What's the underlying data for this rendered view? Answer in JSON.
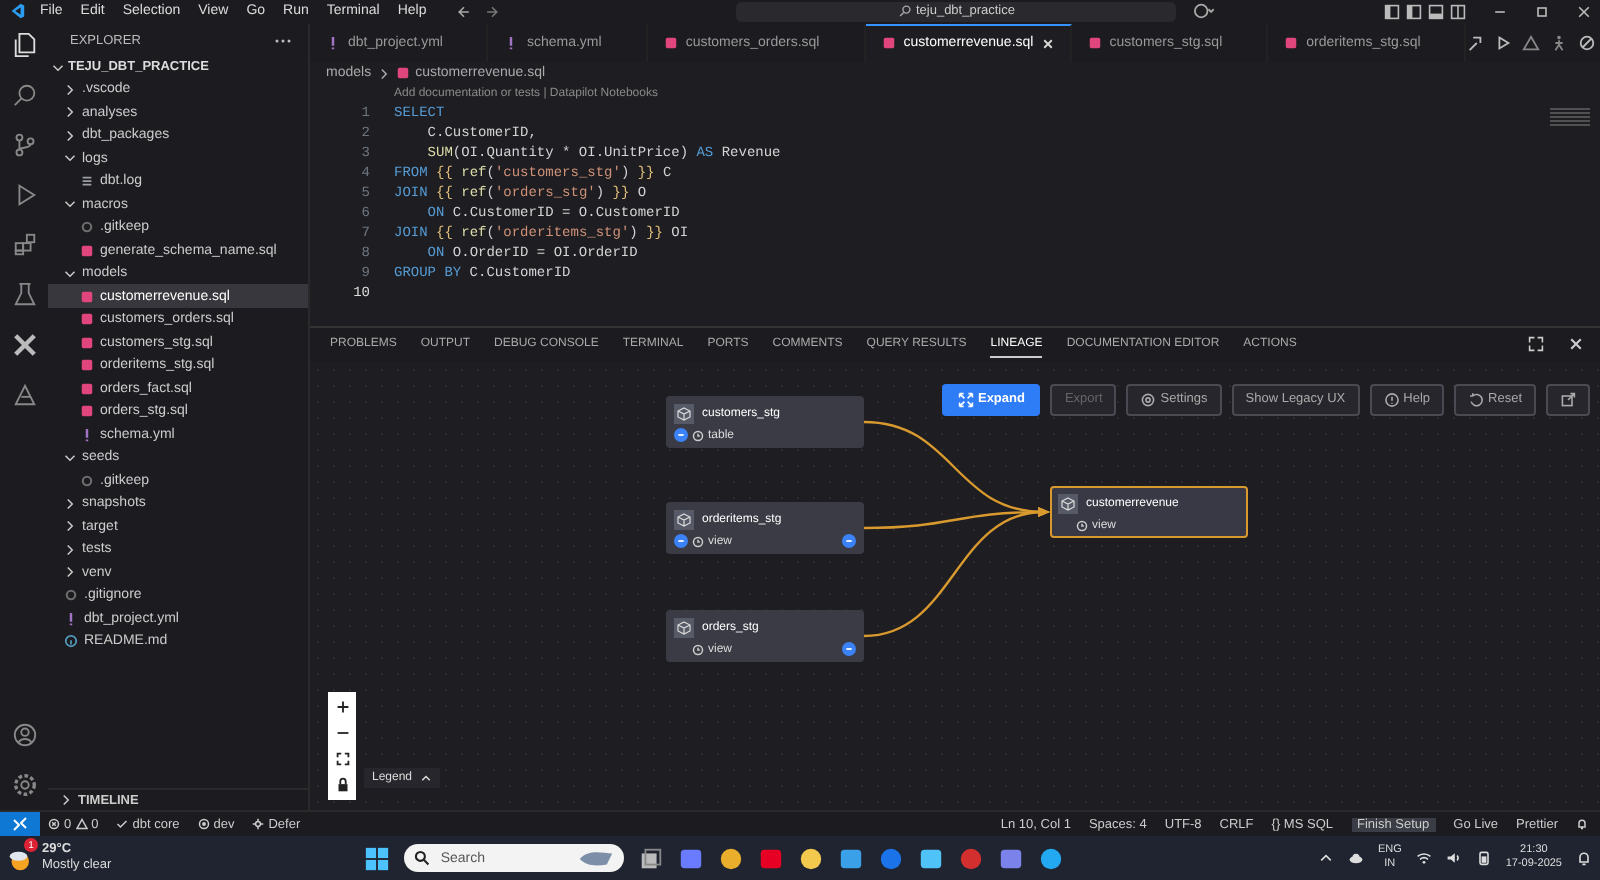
{
  "titlebar": {
    "menu": [
      "File",
      "Edit",
      "Selection",
      "View",
      "Go",
      "Run",
      "Terminal",
      "Help"
    ],
    "search": {
      "value": "teju_dbt_practice"
    }
  },
  "sidebar": {
    "title": "EXPLORER",
    "project": {
      "label": "TEJU_DBT_PRACTICE",
      "expanded": true
    },
    "items": [
      {
        "label": ".vscode",
        "kind": "folder",
        "expanded": false,
        "selected": false
      },
      {
        "label": "analyses",
        "kind": "folder",
        "expanded": false,
        "selected": false
      },
      {
        "label": "dbt_packages",
        "kind": "folder",
        "expanded": false,
        "selected": false
      },
      {
        "label": "logs",
        "kind": "folder",
        "expanded": true,
        "selected": false,
        "children": [
          {
            "label": "dbt.log",
            "kind": "log",
            "selected": false
          }
        ]
      },
      {
        "label": "macros",
        "kind": "folder",
        "expanded": true,
        "selected": false,
        "children": [
          {
            "label": ".gitkeep",
            "kind": "dot",
            "selected": false
          },
          {
            "label": "generate_schema_name.sql",
            "kind": "sql",
            "selected": false
          }
        ]
      },
      {
        "label": "models",
        "kind": "folder",
        "expanded": true,
        "selected": false,
        "children": [
          {
            "label": "customerrevenue.sql",
            "kind": "sql",
            "selected": true
          },
          {
            "label": "customers_orders.sql",
            "kind": "sql",
            "selected": false
          },
          {
            "label": "customers_stg.sql",
            "kind": "sql",
            "selected": false
          },
          {
            "label": "orderitems_stg.sql",
            "kind": "sql",
            "selected": false
          },
          {
            "label": "orders_fact.sql",
            "kind": "sql",
            "selected": false
          },
          {
            "label": "orders_stg.sql",
            "kind": "sql",
            "selected": false
          },
          {
            "label": "schema.yml",
            "kind": "yml",
            "selected": false
          }
        ]
      },
      {
        "label": "seeds",
        "kind": "folder",
        "expanded": true,
        "selected": false,
        "children": [
          {
            "label": ".gitkeep",
            "kind": "dot",
            "selected": false
          }
        ]
      },
      {
        "label": "snapshots",
        "kind": "folder",
        "expanded": false,
        "selected": false
      },
      {
        "label": "target",
        "kind": "folder",
        "expanded": false,
        "selected": false
      },
      {
        "label": "tests",
        "kind": "folder",
        "expanded": false,
        "selected": false
      },
      {
        "label": "venv",
        "kind": "folder",
        "expanded": false,
        "selected": false
      },
      {
        "label": ".gitignore",
        "kind": "dot",
        "selected": false
      },
      {
        "label": "dbt_project.yml",
        "kind": "yml",
        "selected": false
      },
      {
        "label": "README.md",
        "kind": "info",
        "selected": false
      }
    ],
    "timeline": {
      "label": "TIMELINE",
      "expanded": false
    }
  },
  "editor": {
    "tabs": [
      {
        "label": "dbt_project.yml",
        "kind": "yml",
        "selected": false
      },
      {
        "label": "schema.yml",
        "kind": "yml",
        "selected": false
      },
      {
        "label": "customers_orders.sql",
        "kind": "sql",
        "selected": false
      },
      {
        "label": "customerrevenue.sql",
        "kind": "sql",
        "selected": true
      },
      {
        "label": "customers_stg.sql",
        "kind": "sql",
        "selected": false
      },
      {
        "label": "orderitems_stg.sql",
        "kind": "sql",
        "selected": false
      }
    ],
    "breadcrumb": [
      "models",
      "customerrevenue.sql"
    ],
    "codelens": "Add documentation or tests | Datapilot Notebooks",
    "lines": [
      {
        "number": "1",
        "current": false,
        "tokens": [
          {
            "kind": "keyword",
            "text": "SELECT"
          }
        ]
      },
      {
        "number": "2",
        "current": false,
        "tokens": [
          {
            "kind": "plain",
            "text": "    C.CustomerID,"
          }
        ]
      },
      {
        "number": "3",
        "current": false,
        "tokens": [
          {
            "kind": "function",
            "text": "    SUM"
          },
          {
            "kind": "plain",
            "text": "(OI.Quantity * OI.UnitPrice) "
          },
          {
            "kind": "keyword",
            "text": "AS"
          },
          {
            "kind": "plain",
            "text": " Revenue"
          }
        ]
      },
      {
        "number": "4",
        "current": false,
        "tokens": [
          {
            "kind": "keyword",
            "text": "FROM "
          },
          {
            "kind": "brace",
            "text": "{{ "
          },
          {
            "kind": "function",
            "text": "ref"
          },
          {
            "kind": "plain",
            "text": "("
          },
          {
            "kind": "string",
            "text": "'customers_stg'"
          },
          {
            "kind": "plain",
            "text": ") "
          },
          {
            "kind": "brace",
            "text": "}}"
          },
          {
            "kind": "plain",
            "text": " C"
          }
        ]
      },
      {
        "number": "5",
        "current": false,
        "tokens": [
          {
            "kind": "keyword",
            "text": "JOIN "
          },
          {
            "kind": "brace",
            "text": "{{ "
          },
          {
            "kind": "function",
            "text": "ref"
          },
          {
            "kind": "plain",
            "text": "("
          },
          {
            "kind": "string",
            "text": "'orders_stg'"
          },
          {
            "kind": "plain",
            "text": ") "
          },
          {
            "kind": "brace",
            "text": "}}"
          },
          {
            "kind": "plain",
            "text": " O"
          }
        ]
      },
      {
        "number": "6",
        "current": false,
        "tokens": [
          {
            "kind": "keyword",
            "text": "    ON"
          },
          {
            "kind": "plain",
            "text": " C.CustomerID = O.CustomerID"
          }
        ]
      },
      {
        "number": "7",
        "current": false,
        "tokens": [
          {
            "kind": "keyword",
            "text": "JOIN "
          },
          {
            "kind": "brace",
            "text": "{{ "
          },
          {
            "kind": "function",
            "text": "ref"
          },
          {
            "kind": "plain",
            "text": "("
          },
          {
            "kind": "string",
            "text": "'orderitems_stg'"
          },
          {
            "kind": "plain",
            "text": ") "
          },
          {
            "kind": "brace",
            "text": "}}"
          },
          {
            "kind": "plain",
            "text": " OI"
          }
        ]
      },
      {
        "number": "8",
        "current": false,
        "tokens": [
          {
            "kind": "keyword",
            "text": "    ON"
          },
          {
            "kind": "plain",
            "text": " O.OrderID = OI.OrderID"
          }
        ]
      },
      {
        "number": "9",
        "current": false,
        "tokens": [
          {
            "kind": "keyword",
            "text": "GROUP BY"
          },
          {
            "kind": "plain",
            "text": " C.CustomerID"
          }
        ]
      },
      {
        "number": "10",
        "current": true
      }
    ]
  },
  "panel": {
    "tabs": [
      {
        "label": "PROBLEMS",
        "selected": false
      },
      {
        "label": "OUTPUT",
        "selected": false
      },
      {
        "label": "DEBUG CONSOLE",
        "selected": false
      },
      {
        "label": "TERMINAL",
        "selected": false
      },
      {
        "label": "PORTS",
        "selected": false
      },
      {
        "label": "COMMENTS",
        "selected": false
      },
      {
        "label": "QUERY RESULTS",
        "selected": false
      },
      {
        "label": "LINEAGE",
        "selected": true
      },
      {
        "label": "DOCUMENTATION EDITOR",
        "selected": false
      },
      {
        "label": "ACTIONS",
        "selected": false
      }
    ],
    "toolbar": [
      {
        "label": "Expand",
        "kind": "primary"
      },
      {
        "label": "Export",
        "kind": "disabled"
      },
      {
        "label": "Settings",
        "kind": "normal"
      },
      {
        "label": "Show Legacy UX",
        "kind": "normal"
      },
      {
        "label": "Help",
        "kind": "normal"
      },
      {
        "label": "Reset",
        "kind": "normal"
      }
    ],
    "nodes": [
      {
        "name": "customers_stg",
        "materialization": "table",
        "kind": "parent",
        "parents_button": true,
        "children_button": false
      },
      {
        "name": "orderitems_stg",
        "materialization": "view",
        "kind": "parent",
        "parents_button": true,
        "children_button": true
      },
      {
        "name": "orders_stg",
        "materialization": "view",
        "kind": "parent",
        "parents_button": false,
        "children_button": true
      },
      {
        "name": "customerrevenue",
        "materialization": "view",
        "kind": "current",
        "parents_button": false,
        "children_button": false
      }
    ],
    "legend": "Legend"
  },
  "status_bar": {
    "left": [
      {
        "kind": "problems",
        "errors": "0",
        "warnings": "0"
      },
      {
        "kind": "check",
        "text": "dbt core"
      },
      {
        "kind": "target",
        "text": "dev"
      },
      {
        "kind": "defer",
        "text": "Defer"
      }
    ],
    "right": [
      "Ln 10, Col 1",
      "Spaces: 4",
      "UTF-8",
      "CRLF",
      "{} MS SQL",
      "Finish Setup",
      "Go Live",
      "Prettier"
    ]
  },
  "taskbar": {
    "weather": {
      "temp": "29°C",
      "text": "Mostly clear",
      "alerts": "1"
    },
    "search": {
      "placeholder": "Search"
    },
    "language": [
      "ENG",
      "IN"
    ],
    "time": "21:30",
    "date": "17-09-2025"
  }
}
